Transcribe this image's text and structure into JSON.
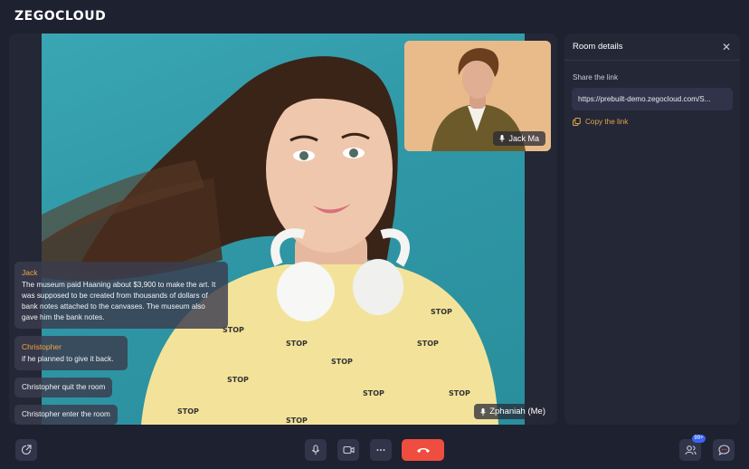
{
  "brand": {
    "logo_text": "ZEGOCLOUD"
  },
  "stage": {
    "main_participant": "Zphaniah (Me)",
    "pip_participant": "Jack Ma"
  },
  "messages": [
    {
      "author": "Jack",
      "text": "The museum paid Haaning about $3,900 to make the art. It was supposed to be created from thousands of dollars of bank notes attached to the canvases. The museum also gave him the bank notes."
    },
    {
      "author": "Christopher",
      "text": "if he planned to give it back."
    }
  ],
  "system_messages": [
    "Christopher quit the room",
    "Christopher enter the room"
  ],
  "room_details": {
    "title": "Room details",
    "share_label": "Share the link",
    "link_value": "https://prebuilt-demo.zegocloud.com/S...",
    "copy_label": "Copy the link"
  },
  "toolbar": {
    "participants_badge": "99+",
    "icons": [
      "share-icon",
      "microphone-icon",
      "camera-icon",
      "more-icon",
      "hang-up-icon",
      "participants-icon",
      "chat-icon"
    ]
  },
  "colors": {
    "accent": "#f3a541",
    "danger": "#ee4d3f",
    "badge": "#3a63f4",
    "background": "#1e2130"
  }
}
